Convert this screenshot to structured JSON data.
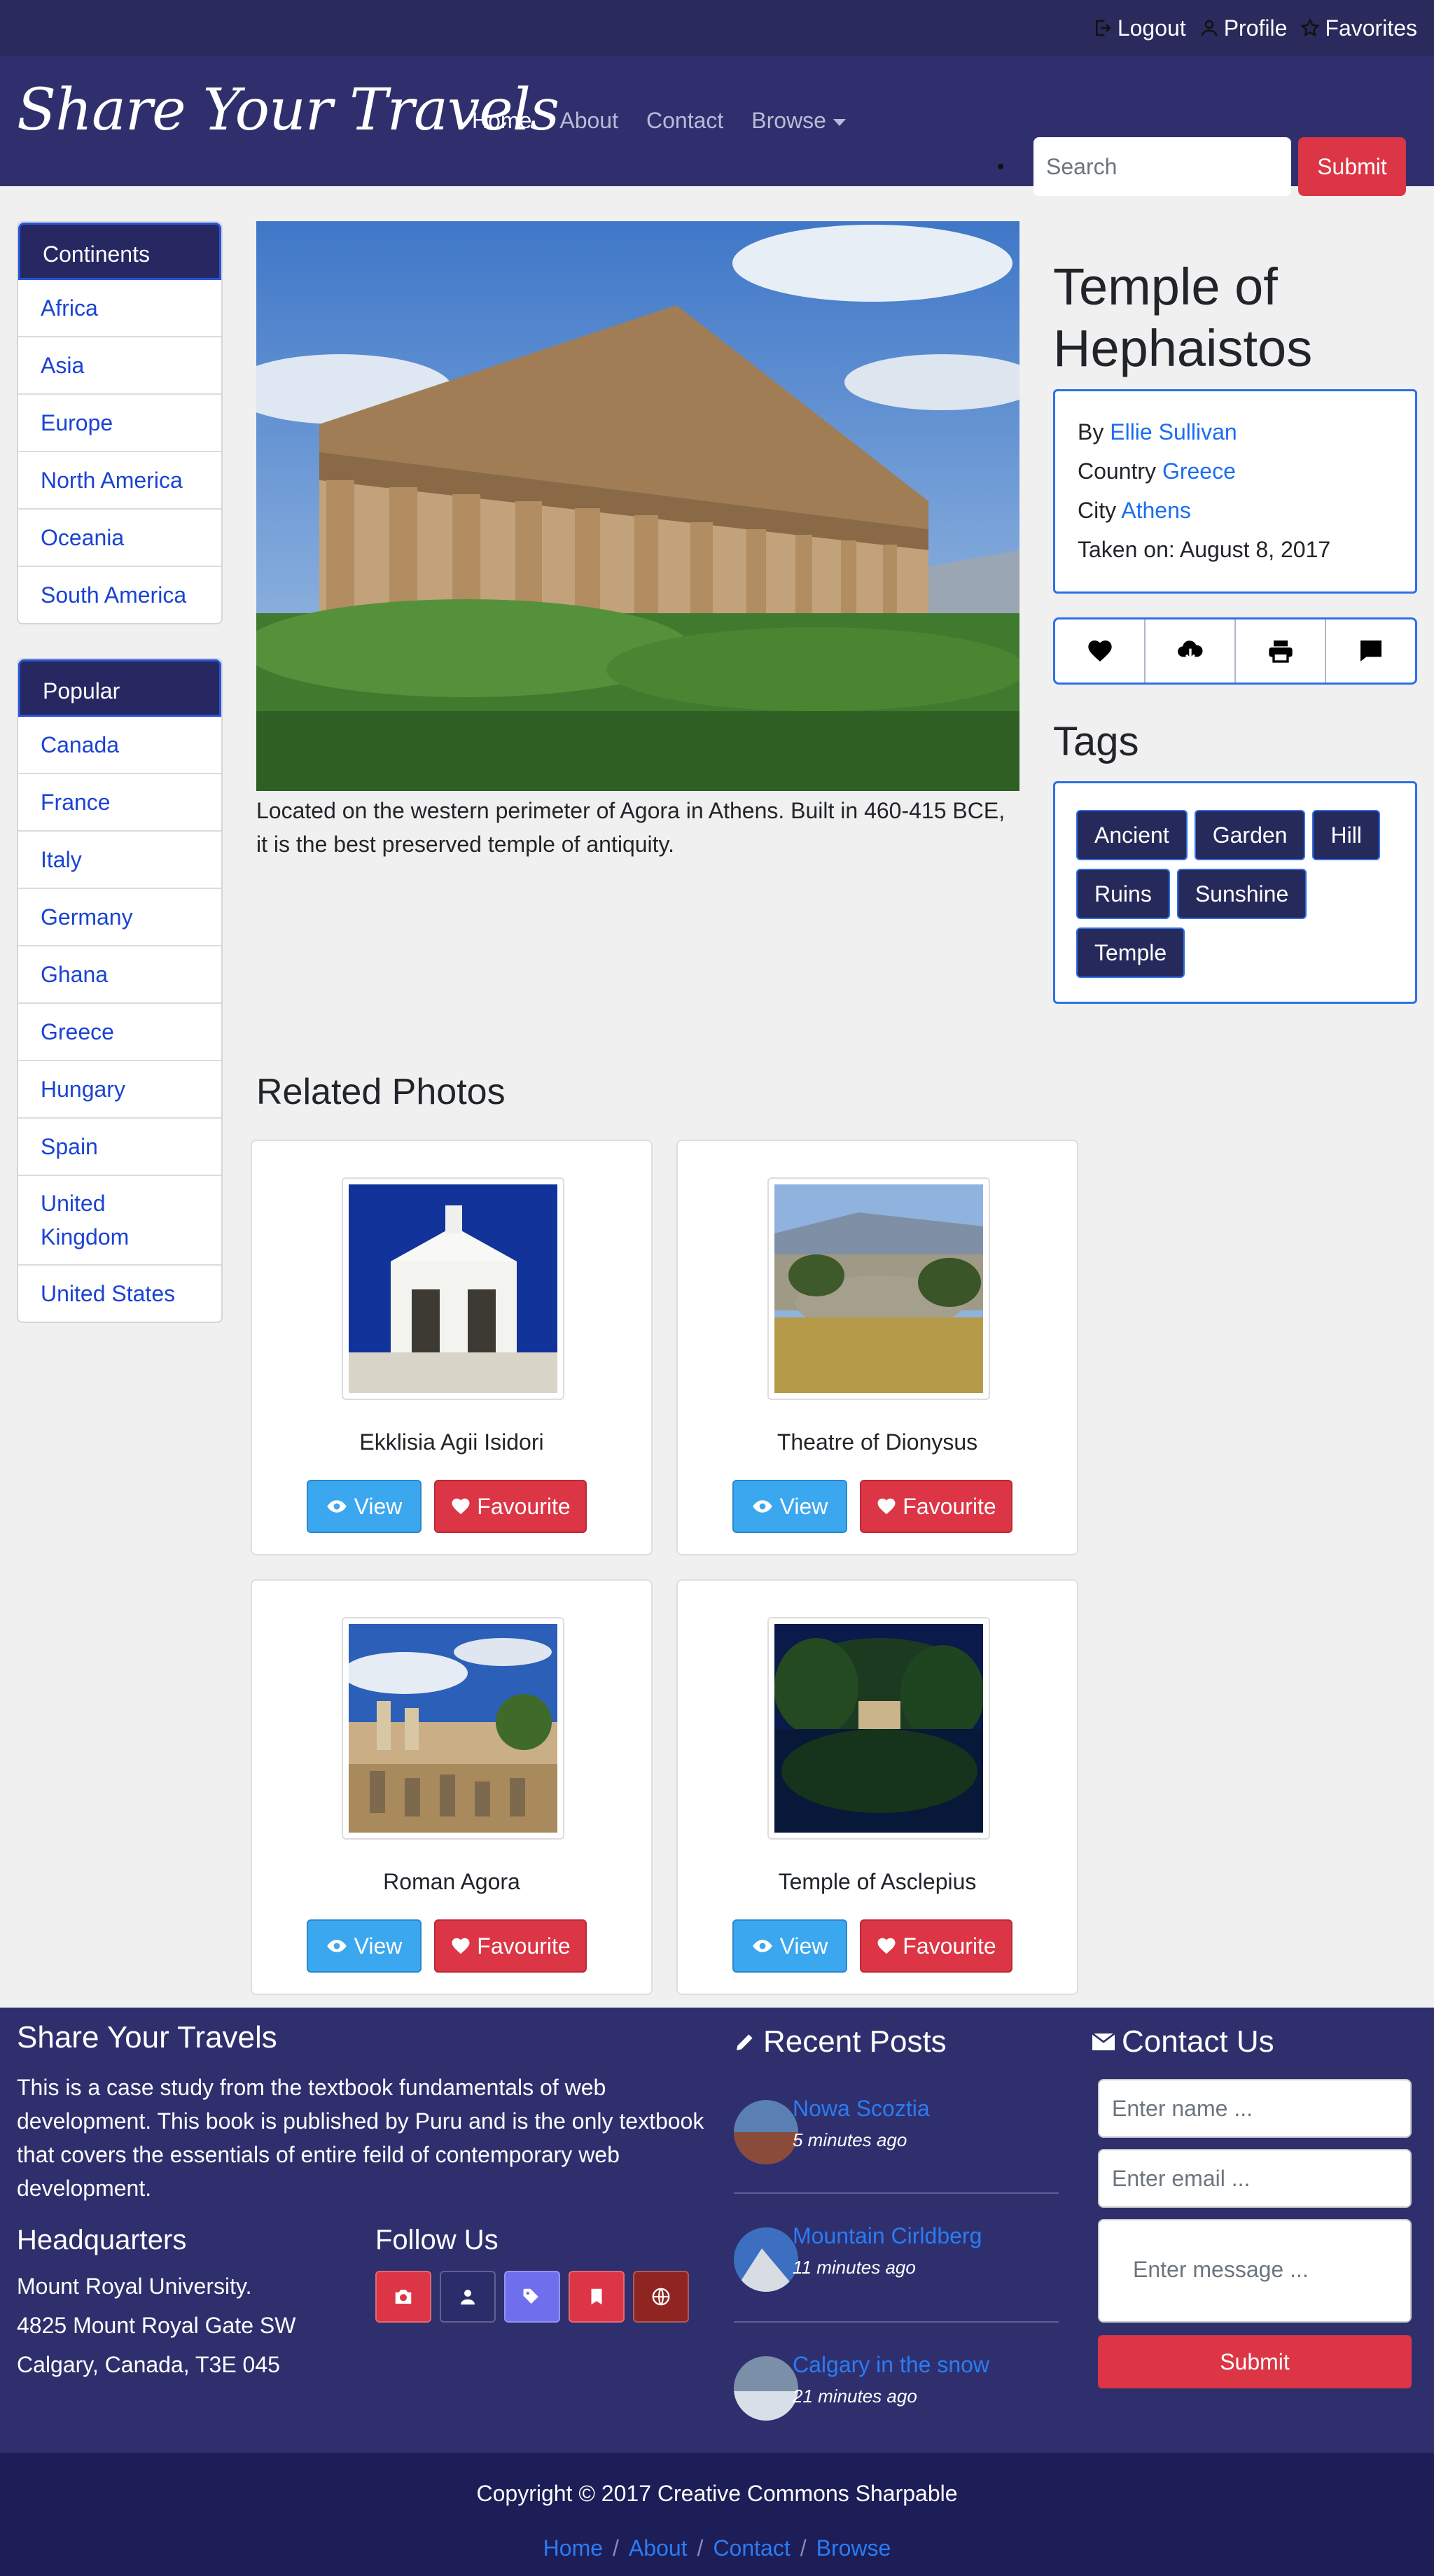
{
  "topbar": {
    "logout": "Logout",
    "profile": "Profile",
    "favorites": "Favorites"
  },
  "navbar": {
    "brand": "Share Your Travels",
    "links": [
      "Home",
      "About",
      "Contact",
      "Browse"
    ],
    "search_placeholder": "Search",
    "submit": "Submit"
  },
  "continents": {
    "title": "Continents",
    "items": [
      "Africa",
      "Asia",
      "Europe",
      "North America",
      "Oceania",
      "South America"
    ]
  },
  "popular": {
    "title": "Popular",
    "items": [
      "Canada",
      "France",
      "Italy",
      "Germany",
      "Ghana",
      "Greece",
      "Hungary",
      "Spain",
      "United Kingdom",
      "United States"
    ]
  },
  "photo": {
    "title": "Temple of Hephaistos",
    "caption": "Located on the western perimeter of Agora in Athens. Built in 460-415 BCE, it is the best preserved temple of antiquity.",
    "by_label": "By",
    "author": "Ellie Sullivan",
    "country_label": "Country",
    "country": "Greece",
    "city_label": "City",
    "city": "Athens",
    "taken": "Taken on: August 8, 2017"
  },
  "actions": [
    "heart-icon",
    "cloud-download-icon",
    "printer-icon",
    "chat-icon"
  ],
  "tags": {
    "title": "Tags",
    "items": [
      "Ancient",
      "Garden",
      "Hill",
      "Ruins",
      "Sunshine",
      "Temple"
    ]
  },
  "related": {
    "title": "Related Photos",
    "view_label": "View",
    "fav_label": "Favourite",
    "items": [
      {
        "name": "Ekklisia Agii Isidori"
      },
      {
        "name": "Theatre of Dionysus"
      },
      {
        "name": "Roman Agora"
      },
      {
        "name": "Temple of Asclepius"
      }
    ]
  },
  "footer": {
    "about_title": "Share Your Travels",
    "about_text": "This is a case study from the textbook fundamentals of web development. This book is published by Puru and is the only textbook that covers the essentials of entire feild of contemporary web development.",
    "hq_title": "Headquarters",
    "hq_lines": [
      "Mount Royal University.",
      "4825 Mount Royal Gate SW",
      "Calgary, Canada, T3E 045"
    ],
    "follow_title": "Follow Us",
    "social": [
      "camera-icon",
      "person-icon",
      "tags-icon",
      "bookmark-icon",
      "globe-icon"
    ],
    "social_colors": [
      "#dc3545",
      "#2b2d6b",
      "#6f6fee",
      "#dc3545",
      "#8f2420"
    ],
    "posts_title": "Recent Posts",
    "posts": [
      {
        "title": "Nowa Scoztia",
        "time": "5 minutes ago"
      },
      {
        "title": "Mountain Cirldberg",
        "time": "11 minutes ago"
      },
      {
        "title": "Calgary in the snow",
        "time": "21 minutes ago"
      }
    ],
    "contact_title": "Contact Us",
    "name_placeholder": "Enter name ...",
    "email_placeholder": "Enter email ...",
    "message_placeholder": "Enter message ...",
    "contact_submit": "Submit"
  },
  "bottom": {
    "copyright": "Copyright © 2017 Creative Commons Sharpable",
    "links": [
      "Home",
      "About",
      "Contact",
      "Browse"
    ]
  }
}
